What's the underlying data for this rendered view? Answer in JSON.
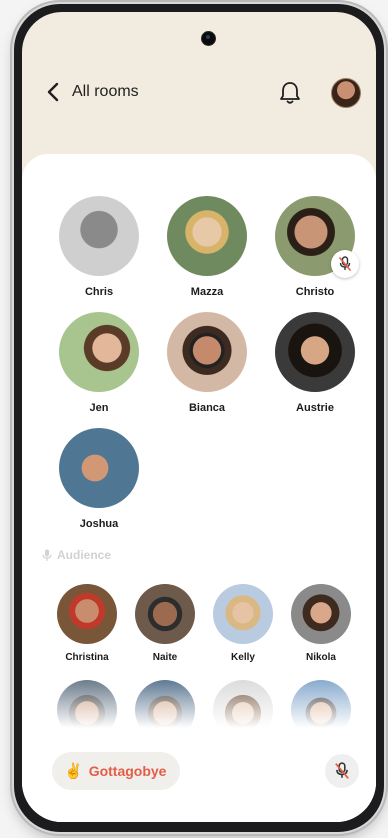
{
  "header": {
    "back_label": "All rooms"
  },
  "speakers": [
    {
      "name": "Chris",
      "muted": false
    },
    {
      "name": "Mazza",
      "muted": false
    },
    {
      "name": "Christo",
      "muted": true
    },
    {
      "name": "Jen",
      "muted": false
    },
    {
      "name": "Bianca",
      "muted": false
    },
    {
      "name": "Austrie",
      "muted": false
    },
    {
      "name": "Joshua",
      "muted": false
    }
  ],
  "audience_label": "Audience",
  "audience": [
    {
      "name": "Christina"
    },
    {
      "name": "Naite"
    },
    {
      "name": "Kelly"
    },
    {
      "name": "Nikola"
    },
    {
      "name": ""
    },
    {
      "name": ""
    },
    {
      "name": ""
    },
    {
      "name": ""
    }
  ],
  "footer": {
    "leave_label": "Gottagobye",
    "leave_emoji": "✌️"
  },
  "colors": {
    "accent": "#e35d48",
    "header_bg": "#f1ecdf",
    "button_bg": "#f0efec"
  },
  "icons": [
    "back-arrow-icon",
    "bell-icon",
    "mic-off-icon",
    "mic-icon"
  ]
}
